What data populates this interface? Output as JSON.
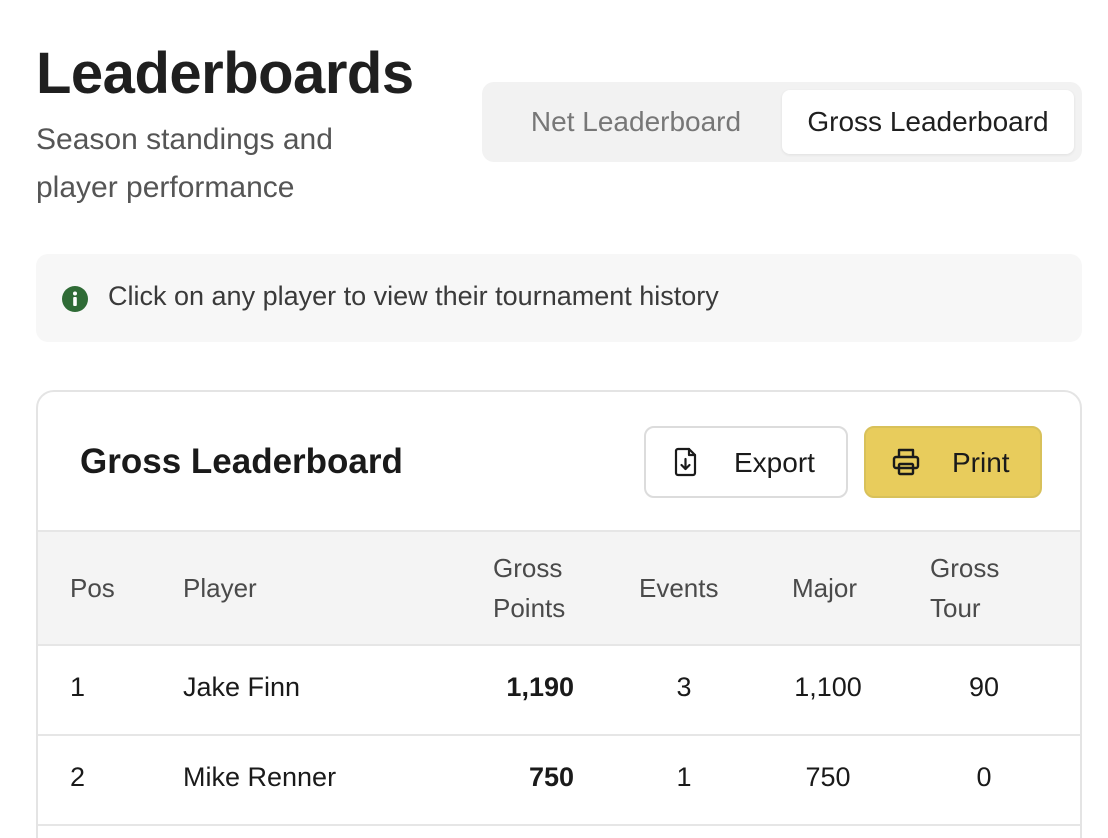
{
  "header": {
    "title": "Leaderboards",
    "subtitle": "Season standings and player performance"
  },
  "tabs": [
    {
      "label": "Net Leaderboard",
      "active": false
    },
    {
      "label": "Gross Leaderboard",
      "active": true
    }
  ],
  "info": {
    "icon": "info-icon",
    "text": "Click on any player to view their tournament history"
  },
  "card": {
    "title": "Gross Leaderboard",
    "export_label": "Export",
    "print_label": "Print",
    "accent_color": "#e8cc5c"
  },
  "table": {
    "columns": [
      "Pos",
      "Player",
      "Gross Points",
      "Events",
      "Major",
      "Gross Tour"
    ],
    "rows": [
      {
        "pos": "1",
        "player": "Jake Finn",
        "gross_points": "1,190",
        "events": "3",
        "major": "1,100",
        "gross_tour": "90"
      },
      {
        "pos": "2",
        "player": "Mike Renner",
        "gross_points": "750",
        "events": "1",
        "major": "750",
        "gross_tour": "0"
      }
    ]
  }
}
